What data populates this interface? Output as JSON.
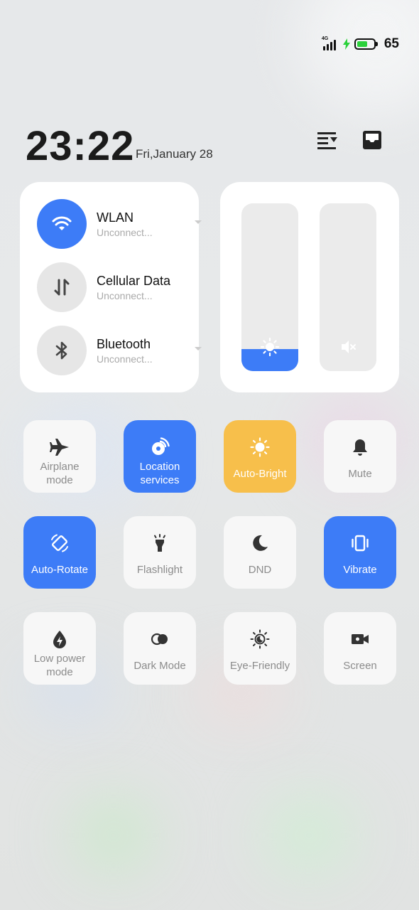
{
  "status_bar": {
    "network_type": "4G",
    "battery_percent": "65",
    "battery_level": 0.65,
    "charging": true,
    "battery_color": "#2bd13b"
  },
  "header": {
    "time": "23:22",
    "date": "Fri,January 28",
    "icons": [
      "notification-shade-edit-icon",
      "inbox-icon"
    ]
  },
  "connectivity": [
    {
      "title": "WLAN",
      "subtitle": "Unconnect...",
      "icon": "wifi-icon",
      "active": true,
      "has_menu": true
    },
    {
      "title": "Cellular Data",
      "subtitle": "Unconnect...",
      "icon": "data-arrows-icon",
      "active": false,
      "has_menu": false
    },
    {
      "title": "Bluetooth",
      "subtitle": "Unconnect...",
      "icon": "bluetooth-icon",
      "active": false,
      "has_menu": true
    }
  ],
  "sliders": {
    "brightness": {
      "icon": "sun-icon",
      "level": 0.13
    },
    "volume": {
      "icon": "volume-mute-icon",
      "level": 0.0
    }
  },
  "tiles": [
    {
      "label": "Airplane mode",
      "lines": [
        "Airplane",
        "mode"
      ],
      "icon": "airplane-icon",
      "state": "off"
    },
    {
      "label": "Location services",
      "lines": [
        "Location",
        "services"
      ],
      "icon": "location-icon",
      "state": "blue"
    },
    {
      "label": "Auto-Bright",
      "lines": [
        "Auto-Bright"
      ],
      "icon": "auto-brightness-icon",
      "state": "yellow"
    },
    {
      "label": "Mute",
      "lines": [
        "Mute"
      ],
      "icon": "bell-icon",
      "state": "off"
    },
    {
      "label": "Auto-Rotate",
      "lines": [
        "Auto-Rotate"
      ],
      "icon": "rotate-icon",
      "state": "blue"
    },
    {
      "label": "Flashlight",
      "lines": [
        "Flashlight"
      ],
      "icon": "flashlight-icon",
      "state": "off"
    },
    {
      "label": "DND",
      "lines": [
        "DND"
      ],
      "icon": "moon-icon",
      "state": "off"
    },
    {
      "label": "Vibrate",
      "lines": [
        "Vibrate"
      ],
      "icon": "vibrate-icon",
      "state": "blue"
    },
    {
      "label": "Low power mode",
      "lines": [
        "Low power",
        "mode"
      ],
      "icon": "low-power-icon",
      "state": "off"
    },
    {
      "label": "Dark Mode",
      "lines": [
        "Dark Mode"
      ],
      "icon": "dark-mode-icon",
      "state": "off"
    },
    {
      "label": "Eye-Friendly",
      "lines": [
        "Eye-Friendly"
      ],
      "icon": "eye-friendly-icon",
      "state": "off"
    },
    {
      "label": "Screen",
      "lines": [
        "Screen"
      ],
      "icon": "screen-record-icon",
      "state": "off"
    }
  ],
  "colors": {
    "accent_blue": "#3d7cf7",
    "accent_yellow": "#f7bf4b",
    "tile_off": "#f7f7f7",
    "label_off": "#8c8c8c"
  }
}
